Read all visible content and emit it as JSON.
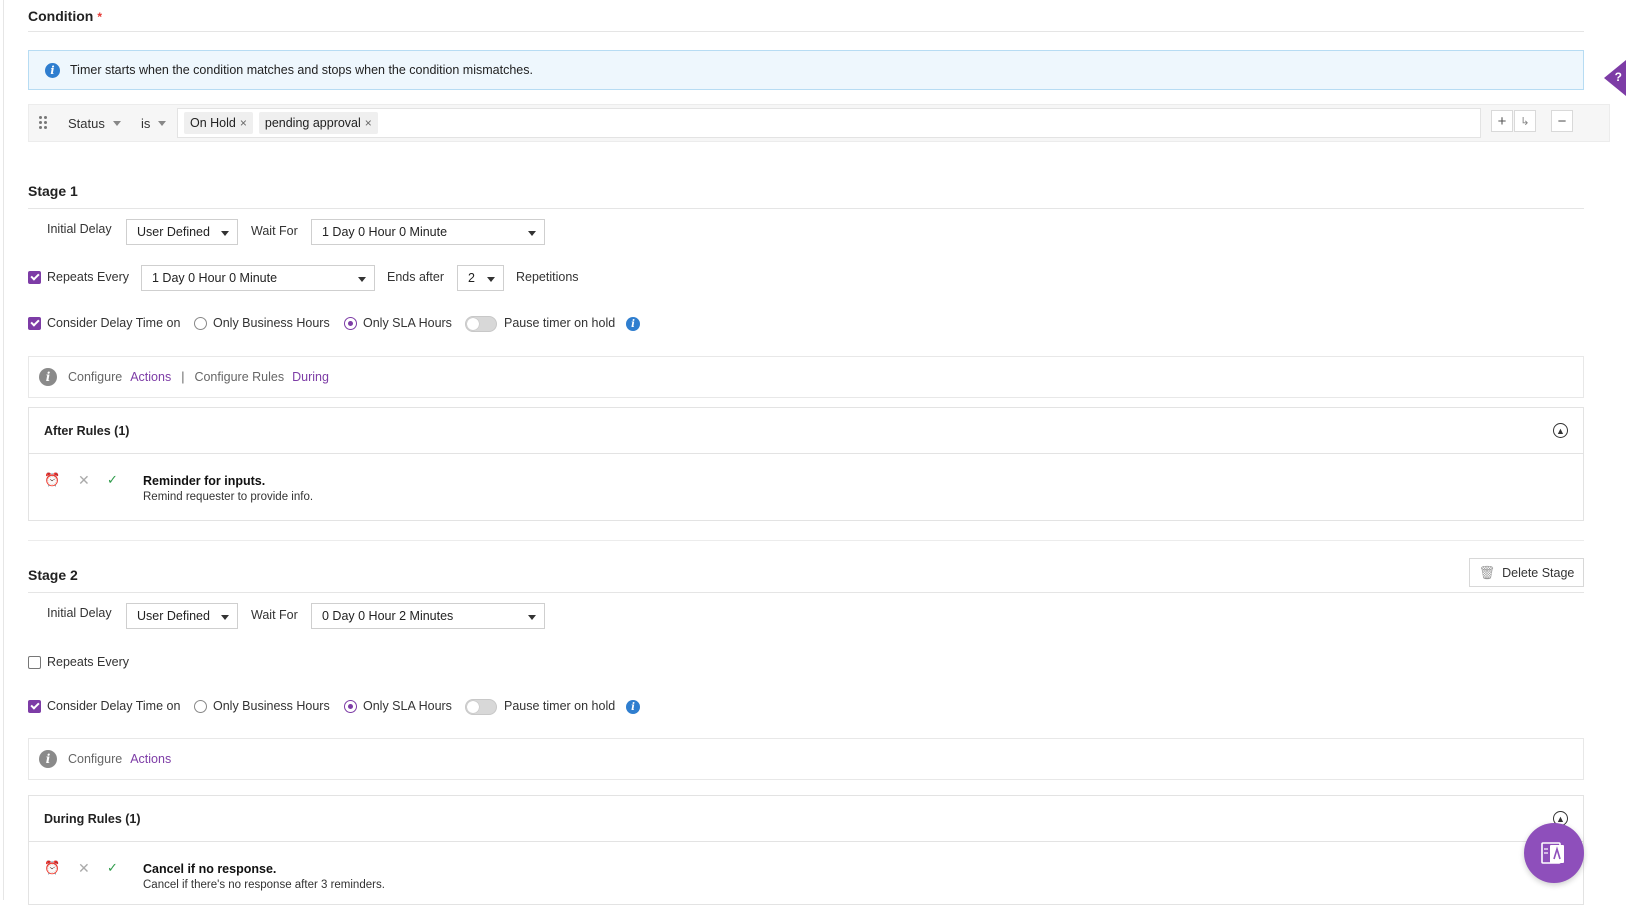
{
  "condition": {
    "title": "Condition",
    "required_mark": "*",
    "info": "Timer starts when the condition matches and stops when the condition mismatches.",
    "field": "Status",
    "operator": "is",
    "tags": [
      "On Hold",
      "pending approval"
    ],
    "tag_remove": "×",
    "add_symbol": "+",
    "sub_symbol": "↳",
    "remove_symbol": "−"
  },
  "stage1": {
    "title": "Stage 1",
    "initial_delay_label": "Initial Delay",
    "initial_delay_value": "User Defined",
    "wait_for_label": "Wait For",
    "wait_for_value": "1 Day 0 Hour 0 Minute",
    "repeats_label": "Repeats Every",
    "repeats_checked": true,
    "repeats_value": "1 Day 0 Hour 0 Minute",
    "ends_after_label": "Ends after",
    "ends_after_value": "2",
    "repetitions_label": "Repetitions",
    "consider_label": "Consider Delay Time on",
    "business_hours_label": "Only Business Hours",
    "sla_hours_label": "Only SLA Hours",
    "pause_label": "Pause timer on hold",
    "configure_label": "Configure",
    "actions_link": "Actions",
    "separator": "|",
    "configure_rules_label": "Configure Rules",
    "during_link": "During",
    "rules_header": "After Rules (1)",
    "rules": [
      {
        "title": "Reminder for inputs.",
        "description": "Remind requester to provide info."
      }
    ]
  },
  "stage2": {
    "title": "Stage 2",
    "delete_label": "Delete Stage",
    "initial_delay_label": "Initial Delay",
    "initial_delay_value": "User Defined",
    "wait_for_label": "Wait For",
    "wait_for_value": "0 Day 0 Hour 2 Minutes",
    "repeats_label": "Repeats Every",
    "repeats_checked": false,
    "consider_label": "Consider Delay Time on",
    "business_hours_label": "Only Business Hours",
    "sla_hours_label": "Only SLA Hours",
    "pause_label": "Pause timer on hold",
    "configure_label": "Configure",
    "actions_link": "Actions",
    "rules_header": "During Rules (1)",
    "rules": [
      {
        "title": "Cancel if no response.",
        "description": "Cancel if there's no response after 3 reminders."
      }
    ]
  },
  "help_tab": "?",
  "colors": {
    "accent": "#7d3ca6",
    "info_blue": "#2f7ecf",
    "success": "#2e9b4a"
  }
}
